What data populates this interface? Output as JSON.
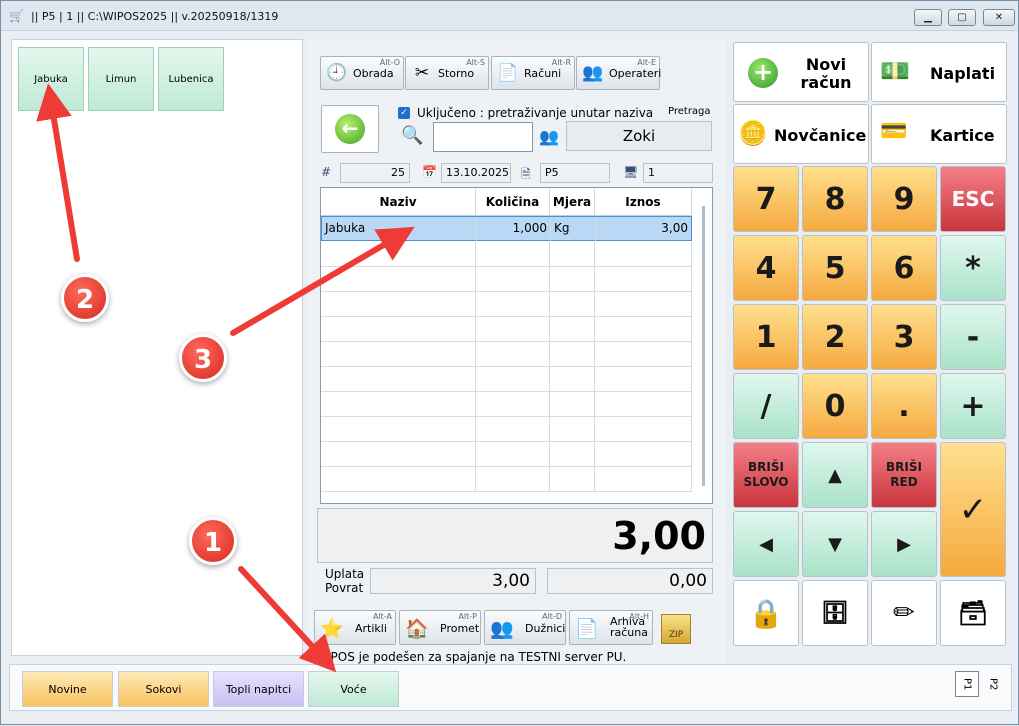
{
  "window": {
    "title": "|| P5 | 1 || C:\\WIPOS2025 || v.20250918/1319",
    "min": "▁",
    "max": "▢",
    "close": "✕"
  },
  "articles": [
    "Jabuka",
    "Limun",
    "Lubenica"
  ],
  "toolbar": [
    {
      "label": "Obrada",
      "alt": "Alt-O"
    },
    {
      "label": "Storno",
      "alt": "Alt-S"
    },
    {
      "label": "Računi",
      "alt": "Alt-R"
    },
    {
      "label": "Operateri",
      "alt": "Alt-E"
    }
  ],
  "search": {
    "checkbox_label": "Uključeno : pretraživanje unutar naziva",
    "title": "Pretraga",
    "value": "",
    "operator": "Zoki"
  },
  "info": {
    "number": "25",
    "date": "13.10.2025",
    "location": "P5",
    "terminal": "1"
  },
  "table": {
    "headers": [
      "Naziv",
      "Količina",
      "Mjera",
      "Iznos"
    ],
    "rows": [
      [
        "Jabuka",
        "1,000",
        "Kg",
        "3,00"
      ]
    ]
  },
  "total": "3,00",
  "payment": {
    "uplata_label": "Uplata",
    "povrat_label": "Povrat",
    "uplata": "3,00",
    "povrat": "0,00"
  },
  "bottom_toolbar": [
    {
      "label": "Artikli",
      "alt": "Alt-A"
    },
    {
      "label": "Promet",
      "alt": "Alt-P"
    },
    {
      "label": "Dužnici",
      "alt": "Alt-D"
    },
    {
      "label": "Arhiva računa",
      "alt": "Alt-H"
    }
  ],
  "zip_label": "ZIP",
  "status": "IPOS je podešen za spajanje na TESTNI server PU.",
  "actions": {
    "novi_racun": "Novi račun",
    "naplati": "Naplati",
    "novcanice": "Novčanice",
    "kartice": "Kartice"
  },
  "keypad": {
    "k7": "7",
    "k8": "8",
    "k9": "9",
    "esc": "ESC",
    "k4": "4",
    "k5": "5",
    "k6": "6",
    "mul": "*",
    "k1": "1",
    "k2": "2",
    "k3": "3",
    "minus": "-",
    "div": "/",
    "k0": "0",
    "dot": ".",
    "plus": "+",
    "brisi_slovo": "BRIŠI SLOVO",
    "brisi_red": "BRIŠI RED",
    "ok": "✓"
  },
  "categories": [
    "Novine",
    "Sokovi",
    "Topli napitci",
    "Voće"
  ],
  "pages": [
    "P1",
    "P2"
  ],
  "annotations": [
    "1",
    "2",
    "3"
  ],
  "colors": {
    "orange": "#f5a93f",
    "mint": "#bfe9d6",
    "red": "#d62a20",
    "selected_row": "#b9d8f5"
  }
}
